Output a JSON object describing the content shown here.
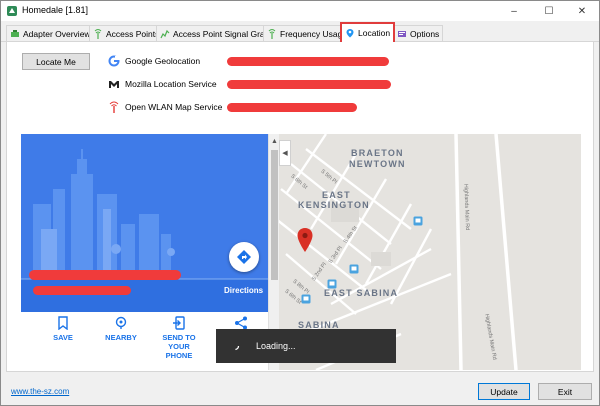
{
  "window": {
    "title": "Homedale [1.81]",
    "icon": "homedale-app-icon",
    "controls": {
      "minimize": "–",
      "maximize": "☐",
      "close": "✕"
    }
  },
  "tabs": [
    {
      "label": "Adapter Overview",
      "icon": "adapter-icon",
      "active": false
    },
    {
      "label": "Access Points",
      "icon": "antenna-icon",
      "active": false
    },
    {
      "label": "Access Point Signal Graph",
      "icon": "signal-graph-icon",
      "active": false
    },
    {
      "label": "Frequency Usage",
      "icon": "antenna-icon",
      "active": false
    },
    {
      "label": "Location",
      "icon": "location-pin-icon",
      "active": true
    },
    {
      "label": "Options",
      "icon": "options-icon",
      "active": false
    }
  ],
  "location": {
    "locate_button": "Locate Me",
    "services": [
      {
        "name": "Google Geolocation",
        "icon": "google-g-icon"
      },
      {
        "name": "Mozilla Location Service",
        "icon": "mozilla-m-icon"
      },
      {
        "name": "Open WLAN Map Service",
        "icon": "antenna-icon"
      }
    ]
  },
  "map": {
    "directions_label": "Directions",
    "actions": [
      {
        "label": "SAVE",
        "icon": "bookmark-icon"
      },
      {
        "label": "NEARBY",
        "icon": "nearby-icon"
      },
      {
        "label": "SEND TO YOUR PHONE",
        "line1": "SEND TO YOUR",
        "line2": "PHONE",
        "icon": "send-to-phone-icon"
      },
      {
        "label": "",
        "icon": "share-icon"
      }
    ],
    "area_labels": {
      "braeton": "BRAETON",
      "newtown": "NEWTOWN",
      "east_kensington_1": "EAST",
      "east_kensington_2": "KENSINGTON",
      "east_sabina": "EAST SABINA",
      "sabina": "SABINA"
    },
    "streets": [
      "S 5th Pl",
      "S 6th St",
      "S 4th St",
      "S 3rd Pl",
      "S 2nd Pl",
      "S 8th Pl",
      "S 6th St",
      "Highlands Main Rd",
      "Highlands Main Rd"
    ],
    "loading_text": "Loading...",
    "colors": {
      "hero": "#3f7be8",
      "marker": "#d93025",
      "accent": "#1a73e8"
    }
  },
  "footer": {
    "link": "www.the-sz.com",
    "update_button": "Update",
    "exit_button": "Exit"
  }
}
